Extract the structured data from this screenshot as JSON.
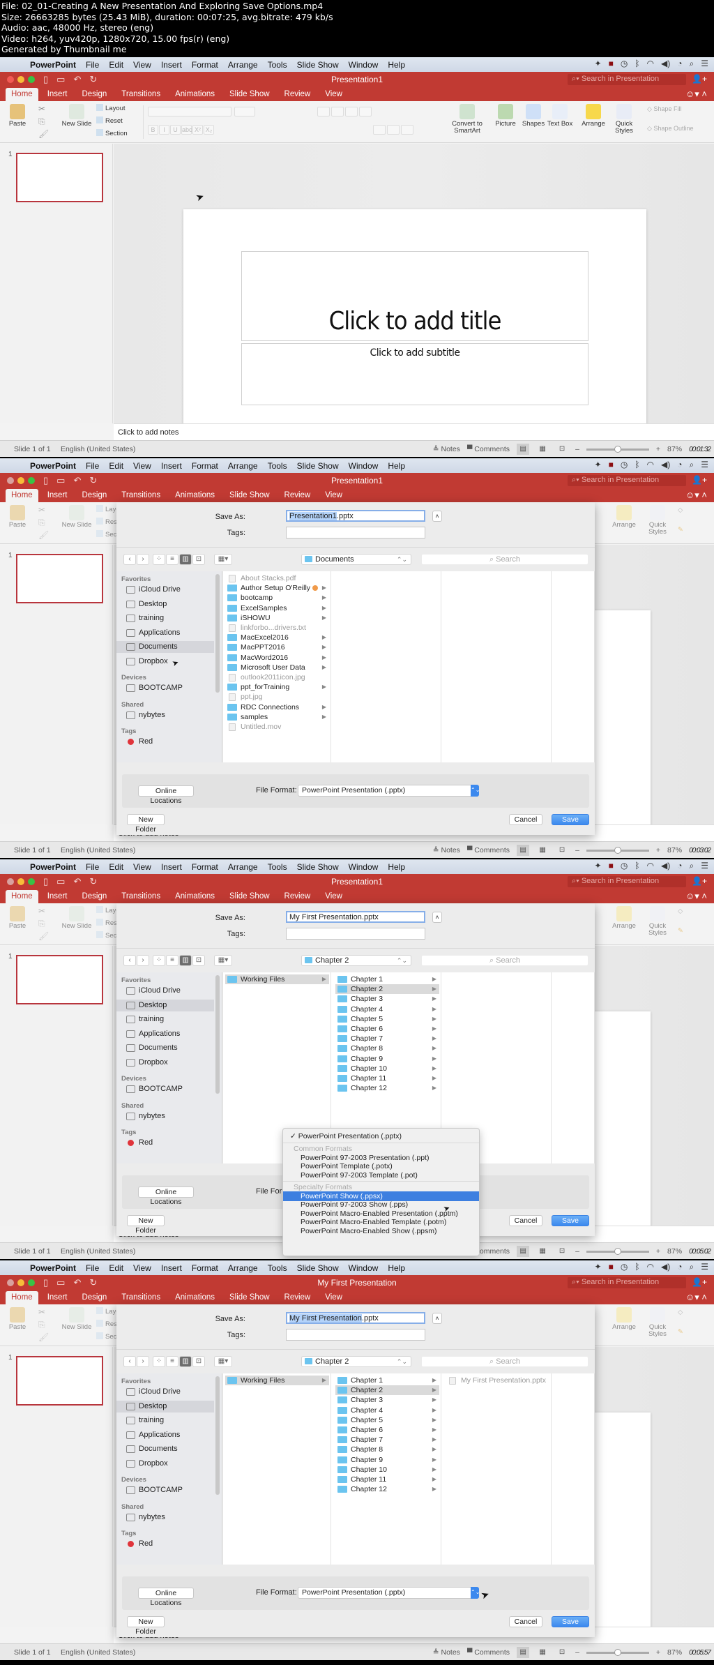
{
  "header": {
    "lines": [
      "File: 02_01-Creating A New Presentation And Exploring Save Options.mp4",
      "Size: 26663285 bytes (25.43 MiB), duration: 00:07:25, avg.bitrate: 479 kb/s",
      "Audio: aac, 48000 Hz, stereo (eng)",
      "Video: h264, yuv420p, 1280x720, 15.00 fps(r) (eng)",
      "Generated by Thumbnail me"
    ]
  },
  "menubar": {
    "app": "PowerPoint",
    "items": [
      "File",
      "Edit",
      "View",
      "Insert",
      "Format",
      "Arrange",
      "Tools",
      "Slide Show",
      "Window",
      "Help"
    ],
    "status_icons": [
      "dropbox-icon",
      "recording-icon",
      "time-machine-icon",
      "bluetooth-icon",
      "wifi-icon",
      "volume-icon",
      "clock-icon",
      "spotlight-icon",
      "notification-center-icon"
    ]
  },
  "ribbon": {
    "tabs": [
      "Home",
      "Insert",
      "Design",
      "Transitions",
      "Animations",
      "Slide Show",
      "Review",
      "View"
    ],
    "active_tab": "Home",
    "search_placeholder": "Search in Presentation",
    "buttons": {
      "paste": "Paste",
      "new_slide": "New Slide",
      "layout": "Layout",
      "reset": "Reset",
      "section": "Section",
      "convert_smartart": "Convert to SmartArt",
      "picture": "Picture",
      "shapes": "Shapes",
      "text_box": "Text Box",
      "arrange": "Arrange",
      "quick_styles": "Quick Styles",
      "shape_fill": "Shape Fill",
      "shape_outline": "Shape Outline"
    },
    "font_buttons": [
      "B",
      "I",
      "U",
      "abc",
      "X²",
      "X₂"
    ]
  },
  "slide": {
    "number": "1",
    "title_placeholder": "Click to add title",
    "subtitle_placeholder": "Click to add subtitle",
    "notes_placeholder": "Click to add notes"
  },
  "statusbar": {
    "slide_count": "Slide 1 of 1",
    "language": "English (United States)",
    "notes": "Notes",
    "comments": "Comments",
    "zoom_pct": "87%",
    "zoom_level": 0.5
  },
  "frames": [
    {
      "timestamp": "00:01:32",
      "doc_title": "Presentation1",
      "dialog": null
    },
    {
      "timestamp": "00:03:02",
      "doc_title": "Presentation1",
      "dialog": {
        "save_as_label": "Save As:",
        "save_as_selected": "Presentation1",
        "save_as_rest": ".pptx",
        "tags_label": "Tags:",
        "location": "Documents",
        "search_placeholder": "Search",
        "sidebar_active": "Documents",
        "columns": [
          {
            "items": [
              {
                "name": "About Stacks.pdf",
                "type": "file",
                "dim": true
              },
              {
                "name": "Author Setup O'Reilly",
                "type": "folder",
                "tag": true
              },
              {
                "name": "bootcamp",
                "type": "folder"
              },
              {
                "name": "ExcelSamples",
                "type": "folder"
              },
              {
                "name": "iSHOWU",
                "type": "folder"
              },
              {
                "name": "linkforbo...drivers.txt",
                "type": "file",
                "dim": true
              },
              {
                "name": "MacExcel2016",
                "type": "folder"
              },
              {
                "name": "MacPPT2016",
                "type": "folder"
              },
              {
                "name": "MacWord2016",
                "type": "folder"
              },
              {
                "name": "Microsoft User Data",
                "type": "folder"
              },
              {
                "name": "outlook2011icon.jpg",
                "type": "file",
                "dim": true
              },
              {
                "name": "ppt_forTraining",
                "type": "folder"
              },
              {
                "name": "ppt.jpg",
                "type": "file",
                "dim": true
              },
              {
                "name": "RDC Connections",
                "type": "folder"
              },
              {
                "name": "samples",
                "type": "folder"
              },
              {
                "name": "Untitled.mov",
                "type": "file",
                "dim": true
              }
            ]
          }
        ],
        "file_format": "PowerPoint Presentation (.pptx)",
        "popup": null
      }
    },
    {
      "timestamp": "00:05:02",
      "doc_title": "Presentation1",
      "dialog": {
        "save_as_label": "Save As:",
        "save_as_selected": "",
        "save_as_rest": "My First Presentation.pptx",
        "tags_label": "Tags:",
        "location": "Chapter 2",
        "search_placeholder": "Search",
        "sidebar_active": "Desktop",
        "columns": [
          {
            "items": [
              {
                "name": "Working Files",
                "type": "folder",
                "hl": true
              }
            ]
          },
          {
            "items": [
              {
                "name": "Chapter 1",
                "type": "folder"
              },
              {
                "name": "Chapter 2",
                "type": "folder",
                "hl": true
              },
              {
                "name": "Chapter 3",
                "type": "folder"
              },
              {
                "name": "Chapter 4",
                "type": "folder"
              },
              {
                "name": "Chapter 5",
                "type": "folder"
              },
              {
                "name": "Chapter 6",
                "type": "folder"
              },
              {
                "name": "Chapter 7",
                "type": "folder"
              },
              {
                "name": "Chapter 8",
                "type": "folder"
              },
              {
                "name": "Chapter 9",
                "type": "folder"
              },
              {
                "name": "Chapter 10",
                "type": "folder"
              },
              {
                "name": "Chapter 11",
                "type": "folder"
              },
              {
                "name": "Chapter 12",
                "type": "folder"
              }
            ]
          }
        ],
        "file_format": "PowerPoint Presentation (.pptx)",
        "popup": {
          "checked": "PowerPoint Presentation (.pptx)",
          "groups": [
            {
              "heading": "Common Formats",
              "items": [
                "PowerPoint 97-2003 Presentation (.ppt)",
                "PowerPoint Template (.potx)",
                "PowerPoint 97-2003 Template (.pot)"
              ]
            },
            {
              "heading": "Specialty Formats",
              "items": [
                "PowerPoint Show (.ppsx)",
                "PowerPoint 97-2003 Show (.pps)",
                "PowerPoint Macro-Enabled Presentation (.pptm)",
                "PowerPoint Macro-Enabled Template (.potm)",
                "PowerPoint Macro-Enabled Show (.ppsm)"
              ]
            }
          ],
          "highlighted": "PowerPoint Show (.ppsx)"
        }
      }
    },
    {
      "timestamp": "00:05:57",
      "doc_title": "My First Presentation",
      "dialog": {
        "save_as_label": "Save As:",
        "save_as_selected": "My First Presentation",
        "save_as_rest": ".pptx",
        "tags_label": "Tags:",
        "location": "Chapter 2",
        "search_placeholder": "Search",
        "sidebar_active": "Desktop",
        "columns": [
          {
            "items": [
              {
                "name": "Working Files",
                "type": "folder",
                "hl": true
              }
            ]
          },
          {
            "items": [
              {
                "name": "Chapter 1",
                "type": "folder"
              },
              {
                "name": "Chapter 2",
                "type": "folder",
                "hl": true
              },
              {
                "name": "Chapter 3",
                "type": "folder"
              },
              {
                "name": "Chapter 4",
                "type": "folder"
              },
              {
                "name": "Chapter 5",
                "type": "folder"
              },
              {
                "name": "Chapter 6",
                "type": "folder"
              },
              {
                "name": "Chapter 7",
                "type": "folder"
              },
              {
                "name": "Chapter 8",
                "type": "folder"
              },
              {
                "name": "Chapter 9",
                "type": "folder"
              },
              {
                "name": "Chapter 10",
                "type": "folder"
              },
              {
                "name": "Chapter 11",
                "type": "folder"
              },
              {
                "name": "Chapter 12",
                "type": "folder"
              }
            ]
          },
          {
            "items": [
              {
                "name": "My First Presentation.pptx",
                "type": "file",
                "dim": true
              }
            ]
          }
        ],
        "file_format": "PowerPoint Presentation (.pptx)",
        "popup": null
      }
    }
  ],
  "dialog_common": {
    "sidebar": {
      "sections": [
        {
          "heading": "Favorites",
          "items": [
            "iCloud Drive",
            "Desktop",
            "training",
            "Applications",
            "Documents",
            "Dropbox"
          ]
        },
        {
          "heading": "Devices",
          "items": [
            "BOOTCAMP"
          ]
        },
        {
          "heading": "Shared",
          "items": [
            "nybytes"
          ]
        },
        {
          "heading": "Tags",
          "items": [
            "Red"
          ]
        }
      ]
    },
    "online_locations": "Online Locations",
    "file_format_label": "File Format:",
    "new_folder": "New Folder",
    "cancel": "Cancel",
    "save": "Save"
  },
  "colors": {
    "titlebar": "#c13a33",
    "accent_blue": "#3c89ee",
    "thumb_border": "#b8353d",
    "tag_red": "#e0343b",
    "folder_blue": "#6bc4ef"
  }
}
